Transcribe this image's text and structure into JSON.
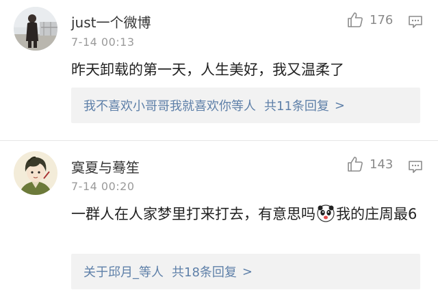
{
  "comments": [
    {
      "username": "just一个微博",
      "timestamp": "7-14 00:13",
      "likes": "176",
      "content": "昨天卸载的第一天，人生美好，我又温柔了",
      "replies": {
        "who": "我不喜欢小哥哥我就喜欢你等人",
        "count": "共11条回复",
        "chevron": ">"
      }
    },
    {
      "username": "寞夏与蓦笙",
      "timestamp": "7-14 00:20",
      "likes": "143",
      "content_before": "一群人在人家梦里打来打去，有意思吗",
      "content_after": "我的庄周最6",
      "replies": {
        "who": "关于邱月_等人",
        "count": "共18条回复",
        "chevron": ">"
      }
    }
  ],
  "icons": {
    "like": "thumbs-up-icon",
    "reply": "comment-bubble-icon",
    "emoji": "panda-face-emoji"
  },
  "colors": {
    "link": "#5d7fa8",
    "meta": "#9a9a9a",
    "reply_bg": "#f2f2f2"
  }
}
